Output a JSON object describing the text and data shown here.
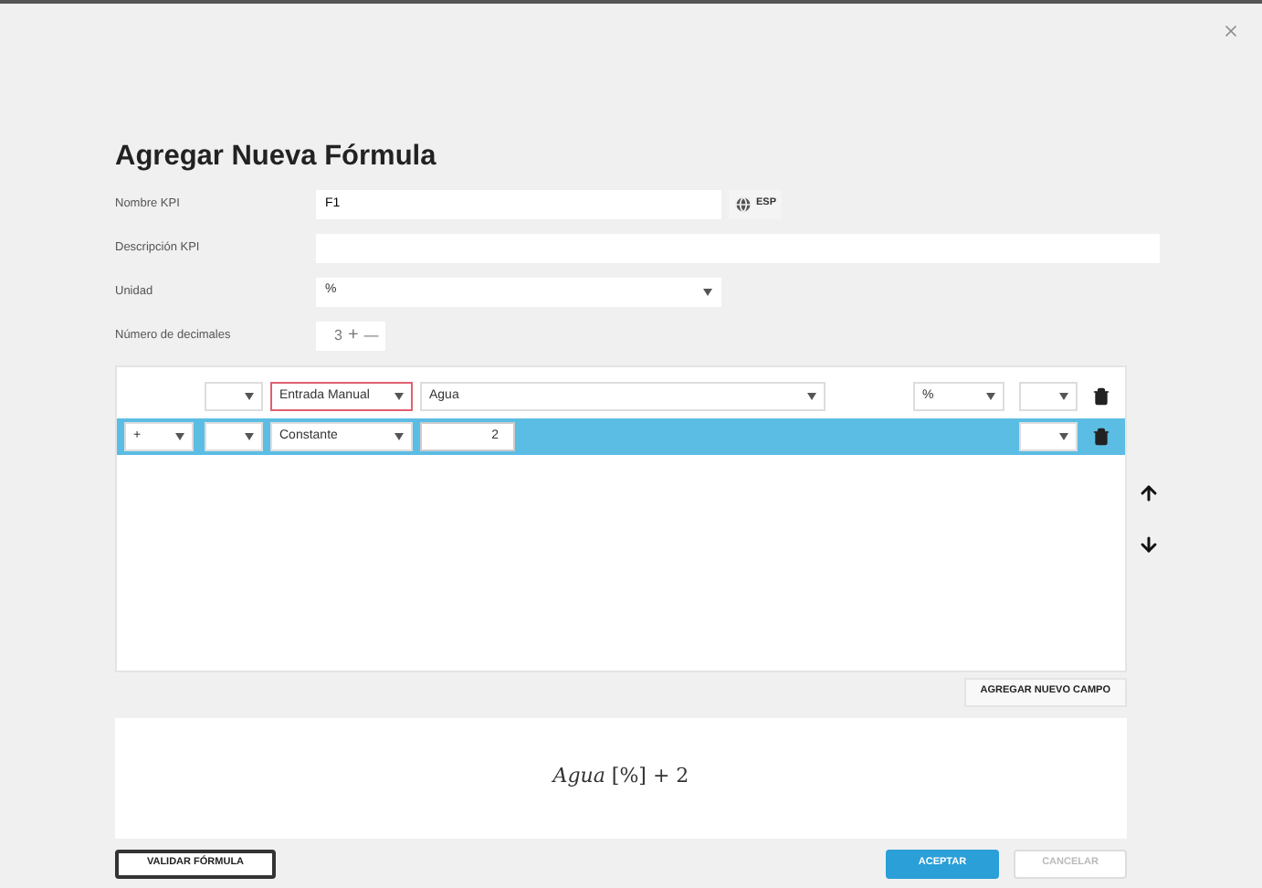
{
  "dialog": {
    "title": "Agregar Nueva Fórmula"
  },
  "form": {
    "nombre": {
      "label": "Nombre KPI",
      "value": "F1"
    },
    "language_button": "ESP",
    "descripcion": {
      "label": "Descripción KPI"
    },
    "unidad": {
      "label": "Unidad",
      "value": "%"
    },
    "decimales": {
      "label": "Número de decimales",
      "value": "3",
      "plus": "+",
      "minus": "—"
    }
  },
  "rows": [
    {
      "selected": false,
      "cells": [
        {
          "kind": "paren"
        },
        {
          "kind": "type",
          "value": "Entrada Manual",
          "error": true
        },
        {
          "kind": "source",
          "value": "Agua"
        },
        {
          "kind": "unit",
          "value": "%"
        },
        {
          "kind": "close"
        }
      ]
    },
    {
      "selected": true,
      "cells": [
        {
          "kind": "operator",
          "value": "+"
        },
        {
          "kind": "paren"
        },
        {
          "kind": "type",
          "value": "Constante",
          "error": false
        },
        {
          "kind": "number",
          "value": "2"
        },
        {
          "kind": "close"
        }
      ]
    }
  ],
  "add_field_button": "AGREGAR NUEVO CAMPO",
  "preview": "*Agua* [%] + 2",
  "buttons": [
    {
      "label": "VALIDAR FÓRMULA",
      "kind": "outline",
      "disabled": false
    },
    {
      "label": "ACEPTAR",
      "kind": "primary",
      "disabled": false
    },
    {
      "label": "CANCELAR",
      "kind": "plain",
      "disabled": true
    }
  ]
}
